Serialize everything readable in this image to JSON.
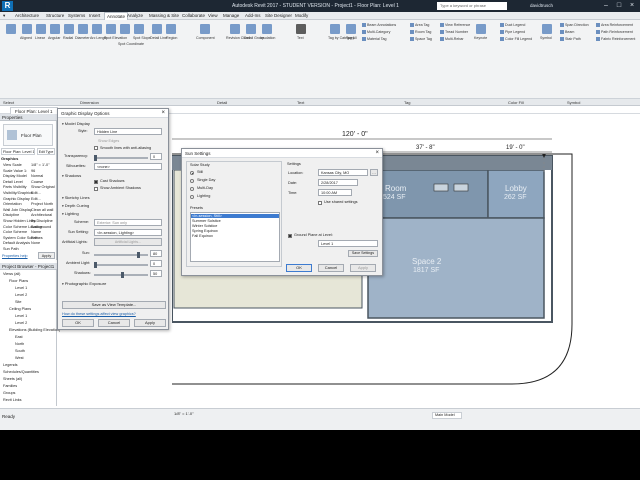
{
  "titlebar": {
    "app_title": "Autodesk Revit 2017 - STUDENT VERSION - Project1 - Floor Plan: Level 1",
    "search_placeholder": "Type a keyword or phrase",
    "user": "davidtrusch"
  },
  "menu_tabs": [
    "Architecture",
    "Structure",
    "Systems",
    "Insert",
    "Annotate",
    "Analyze",
    "Massing & Site",
    "Collaborate",
    "View",
    "Manage",
    "Add-Ins",
    "Site Designer",
    "Modify"
  ],
  "active_tab": "Annotate",
  "ribbon": {
    "dimension_tools": [
      "Aligned",
      "Linear",
      "Angular",
      "Radial",
      "Diameter",
      "Arc Length",
      "Spot Elevation",
      "Spot Coordinate",
      "Spot Slope"
    ],
    "detail_tools": [
      "Detail Line",
      "Region",
      "Component",
      "Revision Cloud",
      "Detail Group",
      "Insulation"
    ],
    "text_label": "Text",
    "tag_tools": [
      "Tag by Category",
      "Tag All",
      "Beam Annotations",
      "Multi-Category",
      "Material Tag",
      "Area Tag",
      "Room Tag",
      "Space Tag",
      "View Reference",
      "Tread Number",
      "Multi-Rebar",
      "Keynote"
    ],
    "color_fill": [
      "Duct Legend",
      "Pipe Legend",
      "Color Fill Legend"
    ],
    "symbol_tools": [
      "Symbol",
      "Span Direction",
      "Beam",
      "Stair Path",
      "Area Reinforcement",
      "Path Reinforcement",
      "Fabric Reinforcement"
    ],
    "groups": [
      "Select",
      "Dimension",
      "Detail",
      "Text",
      "Tag",
      "Color Fill",
      "Symbol"
    ],
    "select_label": "Select"
  },
  "view_tab": "Floor Plan: Level 1",
  "properties": {
    "header": "Properties",
    "type": "Floor Plan",
    "instance": "Floor Plan: Level 1",
    "edit_type": "Edit Type",
    "section": "Graphics",
    "rows": [
      {
        "label": "View Scale",
        "value": "1/8\" = 1'-0\""
      },
      {
        "label": "Scale Value 1:",
        "value": "96"
      },
      {
        "label": "Display Model",
        "value": "Normal"
      },
      {
        "label": "Detail Level",
        "value": "Coarse"
      },
      {
        "label": "Parts Visibility",
        "value": "Show Original"
      },
      {
        "label": "Visibility/Graphics",
        "value": "Edit..."
      },
      {
        "label": "Graphic Display",
        "value": "Edit..."
      },
      {
        "label": "Orientation",
        "value": "Project North"
      },
      {
        "label": "Wall Join Display",
        "value": "Clean all wall"
      },
      {
        "label": "Discipline",
        "value": "Architectural"
      },
      {
        "label": "Show Hidden Lines",
        "value": "By Discipline"
      },
      {
        "label": "Color Scheme Location",
        "value": "Background"
      },
      {
        "label": "Color Scheme",
        "value": "Name"
      },
      {
        "label": "System Color Schemes",
        "value": "Edit..."
      },
      {
        "label": "Default Analysis",
        "value": "None"
      },
      {
        "label": "Sun Path",
        "value": ""
      }
    ],
    "help_link": "Properties help",
    "apply": "Apply"
  },
  "browser": {
    "header": "Project Browser - Project1",
    "items": [
      {
        "label": "Views (all)",
        "indent": 0
      },
      {
        "label": "Floor Plans",
        "indent": 1
      },
      {
        "label": "Level 1",
        "indent": 2
      },
      {
        "label": "Level 2",
        "indent": 2
      },
      {
        "label": "Site",
        "indent": 2
      },
      {
        "label": "Ceiling Plans",
        "indent": 1
      },
      {
        "label": "Level 1",
        "indent": 2
      },
      {
        "label": "Level 2",
        "indent": 2
      },
      {
        "label": "Elevations (Building Elevation)",
        "indent": 1
      },
      {
        "label": "East",
        "indent": 2
      },
      {
        "label": "North",
        "indent": 2
      },
      {
        "label": "South",
        "indent": 2
      },
      {
        "label": "West",
        "indent": 2
      },
      {
        "label": "Legends",
        "indent": 0
      },
      {
        "label": "Schedules/Quantities",
        "indent": 0
      },
      {
        "label": "Sheets (all)",
        "indent": 0
      },
      {
        "label": "Families",
        "indent": 0
      },
      {
        "label": "Groups",
        "indent": 0
      },
      {
        "label": "Revit Links",
        "indent": 0
      }
    ]
  },
  "gdo": {
    "title": "Graphic Display Options",
    "model_display": "Model Display",
    "style_label": "Style:",
    "style_value": "Hidden Line",
    "show_edges": "Show Edges",
    "smooth_lines": "Smooth lines with anti-aliasing",
    "transparency_label": "Transparency:",
    "transparency_value": "0",
    "silhouettes_label": "Silhouettes:",
    "silhouettes_value": "<none>",
    "shadows": "Shadows",
    "cast_shadows": "Cast Shadows",
    "show_ambient": "Show Ambient Shadows",
    "sketchy_lines": "Sketchy Lines",
    "depth_cueing": "Depth Cueing",
    "lighting": "Lighting",
    "scheme_label": "Scheme:",
    "scheme_value": "Exterior: Sun only",
    "sun_setting_label": "Sun Setting:",
    "sun_setting_value": "<In-session, Lighting>",
    "artificial_lights_label": "Artificial Lights:",
    "artificial_lights_btn": "Artificial Lights...",
    "sun_label": "Sun:",
    "sun_value": "80",
    "ambient_label": "Ambient Light:",
    "ambient_value": "0",
    "shadows_label": "Shadows:",
    "shadows_value": "50",
    "photo_exposure": "Photographic Exposure",
    "save_template": "Save as View Template...",
    "help_link": "How do these settings affect view graphics?",
    "ok": "OK",
    "cancel": "Cancel",
    "apply": "Apply"
  },
  "sun": {
    "title": "Sun Settings",
    "study_label": "Solar Study",
    "options": [
      "Still",
      "Single Day",
      "Multi-Day",
      "Lighting"
    ],
    "selected_option": "Still",
    "presets_label": "Presets",
    "presets": [
      "<In-session, Still>",
      "Summer Solstice",
      "Winter Solstice",
      "Spring Equinox",
      "Fall Equinox"
    ],
    "selected_preset": "<In-session, Still>",
    "settings_label": "Settings",
    "location_label": "Location:",
    "location_value": "Kansas City, MO",
    "date_label": "Date:",
    "date_value": "2/28/2017",
    "time_label": "Time:",
    "time_value": "10:00 AM",
    "use_shared": "Use shared settings",
    "ground_plane": "Ground Plane at Level:",
    "ground_value": "Level 1",
    "save_settings": "Save Settings",
    "ok": "OK",
    "cancel": "Cancel",
    "apply": "Apply"
  },
  "plan": {
    "dim_overall": "120' - 0\"",
    "dim_mid": "37' - 8\"",
    "dim_right": "19' - 0\"",
    "room_name": "Room",
    "room_area": "524 SF",
    "lobby_name": "Lobby",
    "lobby_area": "262 SF",
    "space_name": "Space 2",
    "space_area": "1817 SF"
  },
  "status": {
    "ready": "Ready",
    "scale": "1/8\" = 1'-0\"",
    "model": "Main Model"
  },
  "colors": {
    "room_fill": "#7f96ad",
    "lobby_fill": "#8ea6bf",
    "space_fill": "#9fb3c8",
    "left_fill": "#e6e6d7",
    "wall": "#4a5661"
  }
}
